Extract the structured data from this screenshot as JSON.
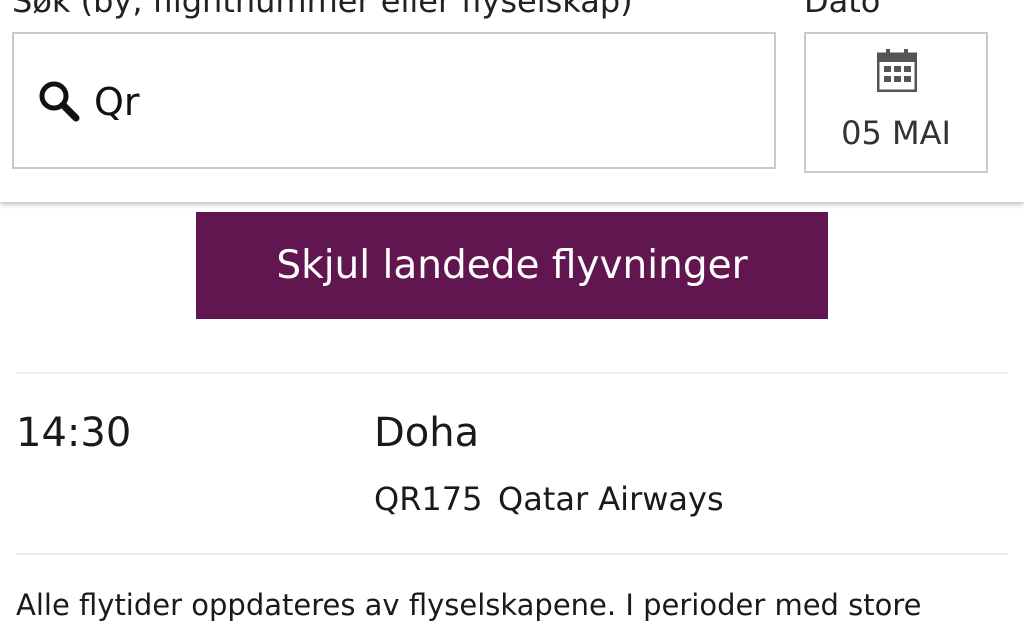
{
  "search": {
    "label": "Søk (by, flightnummer eller flyselskap)",
    "value": "Qr"
  },
  "date": {
    "label": "Dato",
    "value": "05 MAI"
  },
  "toggle_button": {
    "label": "Skjul landede flyvninger",
    "color": "#62164f"
  },
  "flights": [
    {
      "time": "14:30",
      "destination": "Doha",
      "flight_number": "QR175",
      "airline": "Qatar Airways"
    }
  ],
  "footer": {
    "disclaimer": "Alle flytider oppdateres av flyselskapene. I perioder med store"
  },
  "icons": {
    "search": "search-icon",
    "calendar": "calendar-icon"
  }
}
